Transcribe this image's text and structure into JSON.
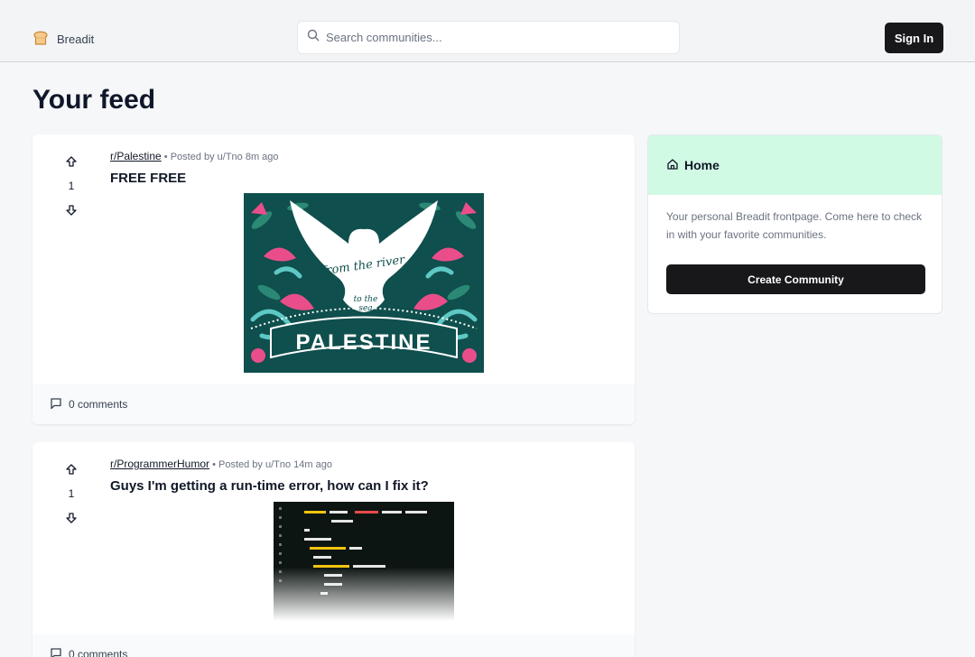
{
  "navbar": {
    "brand": "Breadit",
    "search_placeholder": "Search communities...",
    "sign_in": "Sign In"
  },
  "page_title": "Your feed",
  "posts": [
    {
      "subreddit": "r/Palestine",
      "meta": "Posted by u/Tno 8m ago",
      "votes": "1",
      "title": "FREE FREE",
      "image_text": {
        "script_line1": "from the river",
        "script_line2": "to the",
        "script_line3": "sea",
        "banner": "PALESTINE"
      },
      "comments": "0 comments"
    },
    {
      "subreddit": "r/ProgrammerHumor",
      "meta": "Posted by u/Tno 14m ago",
      "votes": "1",
      "title": "Guys I'm getting a run-time error, how can I fix it?",
      "comments": "0 comments"
    }
  ],
  "sidebar": {
    "title": "Home",
    "description": "Your personal Breadit frontpage. Come here to check in with your favorite communities.",
    "create_button": "Create Community"
  },
  "colors": {
    "accent_dark": "#18181b",
    "sidebar_header": "#d1fae5",
    "poster_teal": "#0f4f4d",
    "poster_pink": "#e94e8a",
    "poster_cyan": "#5ec8c5"
  },
  "icons": [
    "bread-icon",
    "search-icon",
    "arrow-up-icon",
    "arrow-down-icon",
    "comment-icon",
    "home-icon"
  ]
}
